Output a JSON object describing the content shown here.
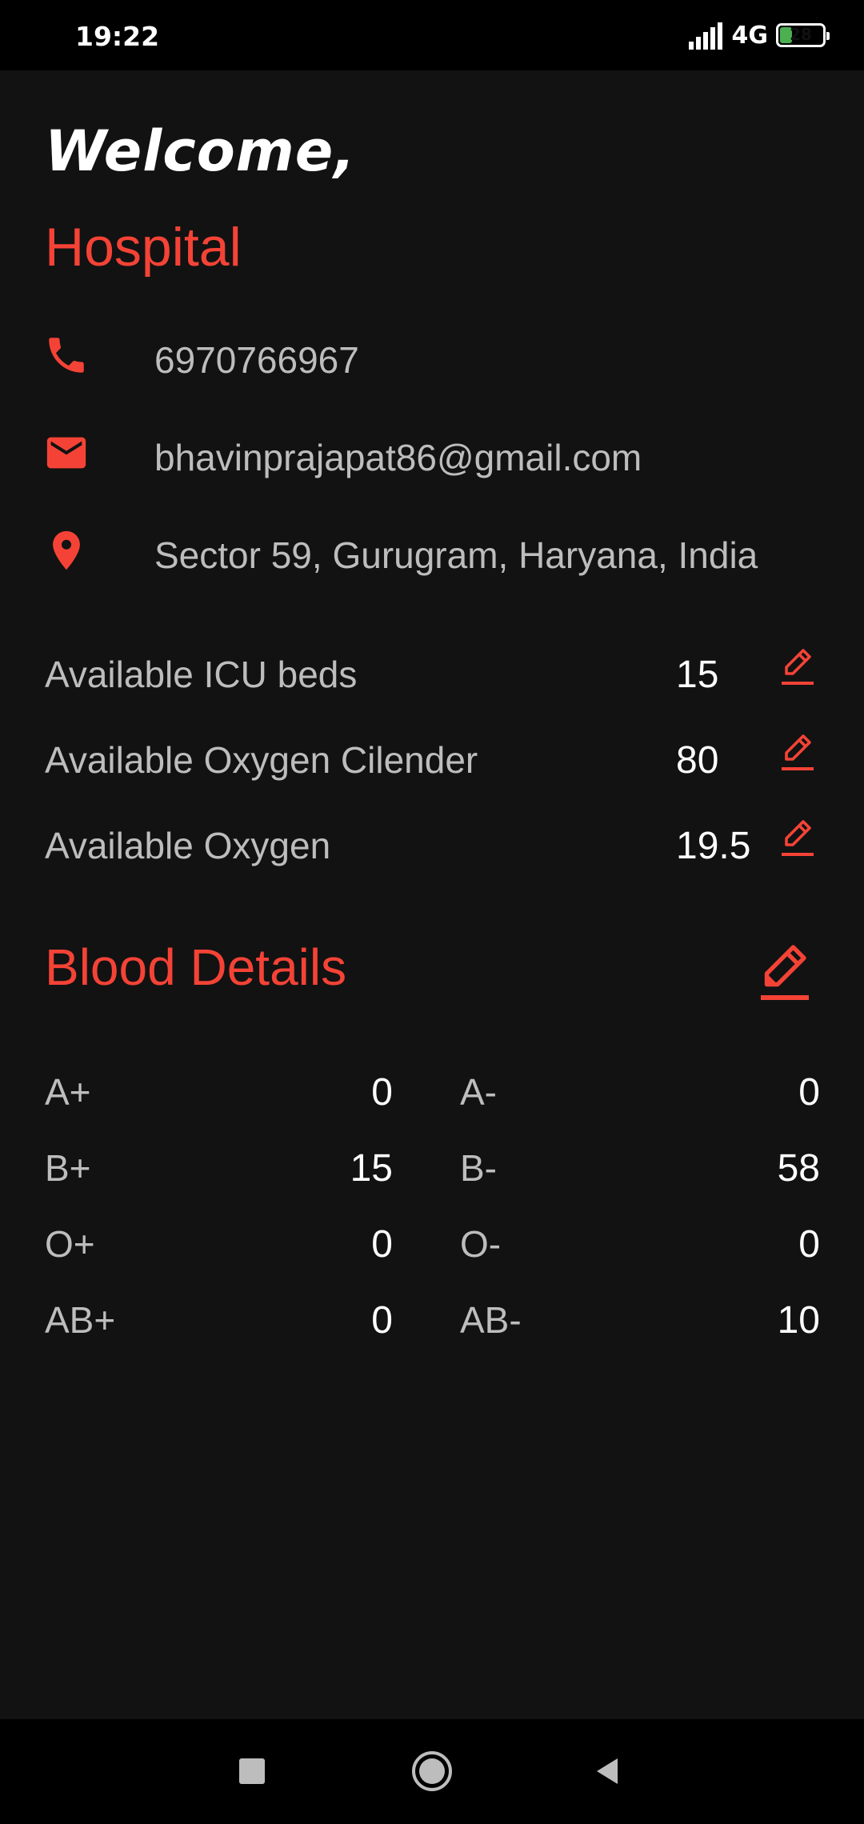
{
  "status_bar": {
    "time": "19:22",
    "network": "4G",
    "battery": "28",
    "battery_level": 0.28
  },
  "header": {
    "welcome": "Welcome,",
    "name": "Hospital"
  },
  "contact": {
    "phone": "6970766967",
    "email": "bhavinprajapat86@gmail.com",
    "address": "Sector 59, Gurugram, Haryana, India"
  },
  "stats": [
    {
      "label": "Available ICU beds",
      "value": "15"
    },
    {
      "label": "Available Oxygen Cilender",
      "value": "80"
    },
    {
      "label": "Available Oxygen",
      "value": "19.5"
    }
  ],
  "blood": {
    "title": "Blood Details",
    "rows": [
      {
        "left_type": "A+",
        "left_count": "0",
        "right_type": "A-",
        "right_count": "0"
      },
      {
        "left_type": "B+",
        "left_count": "15",
        "right_type": "B-",
        "right_count": "58"
      },
      {
        "left_type": "O+",
        "left_count": "0",
        "right_type": "O-",
        "right_count": "0"
      },
      {
        "left_type": "AB+",
        "left_count": "0",
        "right_type": "AB-",
        "right_count": "10"
      }
    ]
  },
  "colors": {
    "accent": "#f44336",
    "background": "#121212",
    "bars": "#000000"
  },
  "icons": {
    "phone": "phone-icon",
    "email": "email-icon",
    "location": "location-pin-icon",
    "edit": "pencil-edit-icon",
    "nav_recents": "square-icon",
    "nav_home": "circle-icon",
    "nav_back": "triangle-back-icon"
  }
}
